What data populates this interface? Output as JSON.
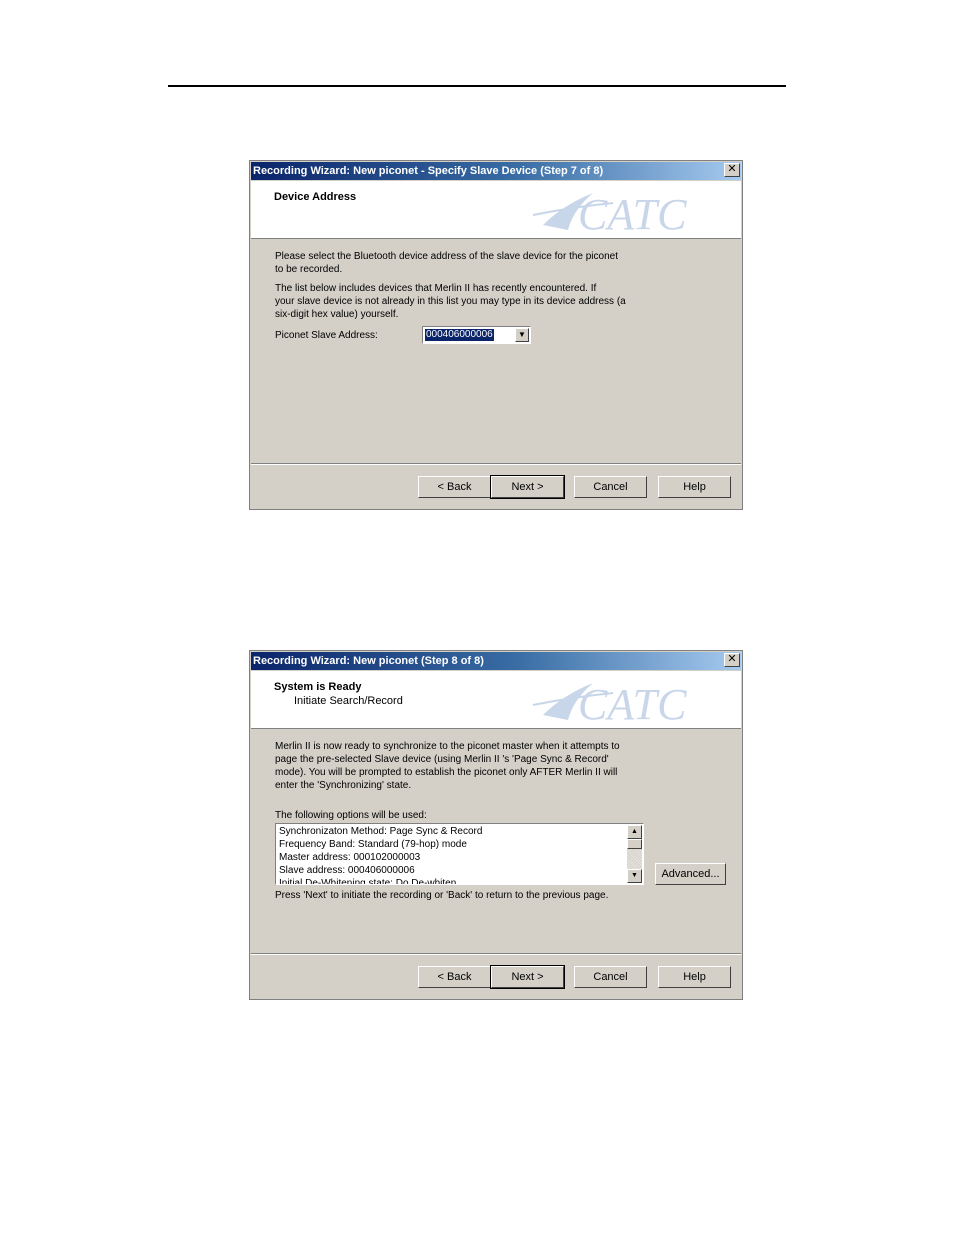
{
  "dialog1": {
    "title": "Recording Wizard: New piconet - Specify Slave Device (Step 7 of 8)",
    "close_glyph": "✕",
    "header_title": "Device Address",
    "logo_text": "CATC",
    "paragraph1_line1": "Please select the Bluetooth device address of the slave device for the piconet",
    "paragraph1_line2": "to be recorded.",
    "paragraph2_line1": "The list below includes devices that  Merlin II has recently encountered.  If",
    "paragraph2_line2": "your slave device is not already in this list you may type in its device address (a",
    "paragraph2_line3": "six-digit hex value) yourself.",
    "address_label": "Piconet Slave Address:",
    "address_value": "000406000006",
    "buttons": {
      "back": "< Back",
      "next": "Next >",
      "cancel": "Cancel",
      "help": "Help"
    }
  },
  "dialog2": {
    "title": "Recording Wizard: New piconet (Step 8 of 8)",
    "close_glyph": "✕",
    "header_title": "System is Ready",
    "header_subtitle": "Initiate Search/Record",
    "logo_text": "CATC",
    "paragraph_line1": "Merlin II  is now ready to synchronize to the piconet master when it attempts to",
    "paragraph_line2": "page the pre-selected Slave device (using Merlin II 's 'Page Sync & Record'",
    "paragraph_line3": "mode). You will be prompted to establish the piconet only AFTER  Merlin II  will",
    "paragraph_line4": "enter the 'Synchronizing' state.",
    "options_label": "The following options will be used:",
    "options": [
      "Synchronizaton Method: Page Sync & Record",
      "Frequency Band: Standard (79-hop) mode",
      "Master address: 000102000003",
      "Slave address: 000406000006",
      "Initial De-Whitening state: Do De-whiten"
    ],
    "advanced_button": "Advanced...",
    "footer_note": "Press 'Next' to initiate the recording or 'Back' to return to the previous page.",
    "buttons": {
      "back": "< Back",
      "next": "Next >",
      "cancel": "Cancel",
      "help": "Help"
    }
  },
  "colors": {
    "titlebar_start": "#0a246a",
    "titlebar_end": "#a6caf0",
    "dialog_face": "#d4d0c8",
    "logo": "#b8c8e0"
  }
}
